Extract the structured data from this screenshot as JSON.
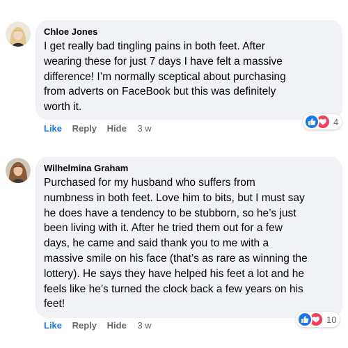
{
  "comments": [
    {
      "author": "Chloe Jones",
      "lines": [
        "I get really bad tingling pains in both feet. After",
        "wearing these for just 7 days I have felt a massive",
        "difference! I’m normally sceptical about purchasing",
        "from adverts on FaceBook but this was definitely",
        "worth it."
      ],
      "actions": {
        "like": "Like",
        "reply": "Reply",
        "hide": "Hide",
        "time": "3 w"
      },
      "reactions": {
        "icons": [
          "like-icon",
          "love-icon"
        ],
        "count": "4"
      }
    },
    {
      "author": "Wilhelmina Graham",
      "lines": [
        "Purchased for my husband who suffers from",
        "numbness in both feet. Love him to bits, but I must say",
        "he does have a tendency to be stubborn, so he’s just",
        "been living with it. After he tried them out for a few",
        "days, he came and said thank you to me with a",
        "massive smile on his face (that’s as rare as winning the",
        "lottery). He says they have helped his feet a lot and he",
        "feels like he’s turned the clock back a few years on his",
        "feet!"
      ],
      "actions": {
        "like": "Like",
        "reply": "Reply",
        "hide": "Hide",
        "time": "3 w"
      },
      "reactions": {
        "icons": [
          "like-icon",
          "love-icon"
        ],
        "count": "10"
      }
    }
  ],
  "colors": {
    "bubble": "#f0f2f5",
    "like_blue": "#1877f2",
    "love_red": "#f33e58",
    "meta_gray": "#65676b"
  }
}
